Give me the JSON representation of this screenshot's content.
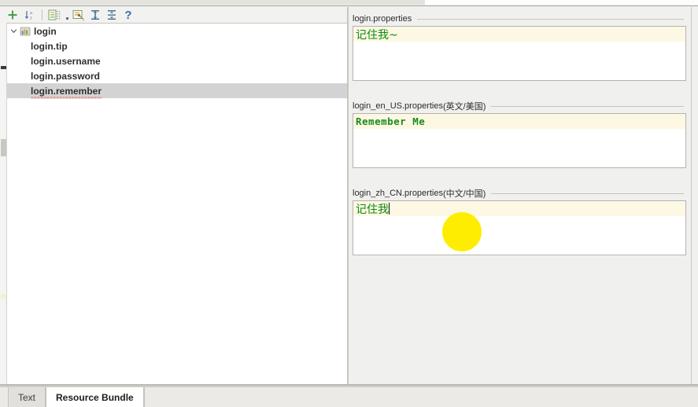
{
  "toolbar": {
    "buttons": [
      {
        "name": "add-property-button",
        "icon": "plus-icon",
        "label": "+"
      },
      {
        "name": "sort-alphabetically-button",
        "icon": "sort-az-icon",
        "label": ""
      },
      {
        "name": "group-by-prefix-button",
        "icon": "tree-list-icon",
        "label": ""
      },
      {
        "name": "overflow-button",
        "icon": "dot-icon",
        "label": ""
      },
      {
        "name": "settings-button",
        "icon": "properties-gear-icon",
        "label": ""
      },
      {
        "name": "expand-all-button",
        "icon": "expand-all-icon",
        "label": ""
      },
      {
        "name": "collapse-all-button",
        "icon": "collapse-all-icon",
        "label": ""
      },
      {
        "name": "help-button",
        "icon": "question-mark-icon",
        "label": "?"
      }
    ]
  },
  "tree": {
    "root": {
      "label": "login",
      "icon": "resource-bundle-icon",
      "expanded": true
    },
    "items": [
      {
        "label": "login.tip",
        "selected": false,
        "spellcheck_error": false
      },
      {
        "label": "login.username",
        "selected": false,
        "spellcheck_error": false
      },
      {
        "label": "login.password",
        "selected": false,
        "spellcheck_error": false
      },
      {
        "label": "login.remember",
        "selected": true,
        "spellcheck_error": true
      }
    ]
  },
  "editors": [
    {
      "title": "login.properties",
      "locale_suffix": "",
      "value": "记住我~",
      "script": "cjk",
      "caret": false
    },
    {
      "title": "login_en_US.properties",
      "locale_suffix": " (英文/美国)",
      "value": "Remember Me",
      "script": "mono",
      "caret": false
    },
    {
      "title": "login_zh_CN.properties",
      "locale_suffix": " (中文/中国)",
      "value": "记住我",
      "script": "cjk",
      "caret": true
    }
  ],
  "tabs": [
    {
      "label": "Text",
      "active": false
    },
    {
      "label": "Resource Bundle",
      "active": true
    }
  ],
  "colors": {
    "value_green": "#0b8a0b",
    "caret_line": "#fdf8e3",
    "selection_gray": "#d3d3d3",
    "click_highlight": "#ffed00",
    "panel_bg": "#f0f0ee"
  }
}
